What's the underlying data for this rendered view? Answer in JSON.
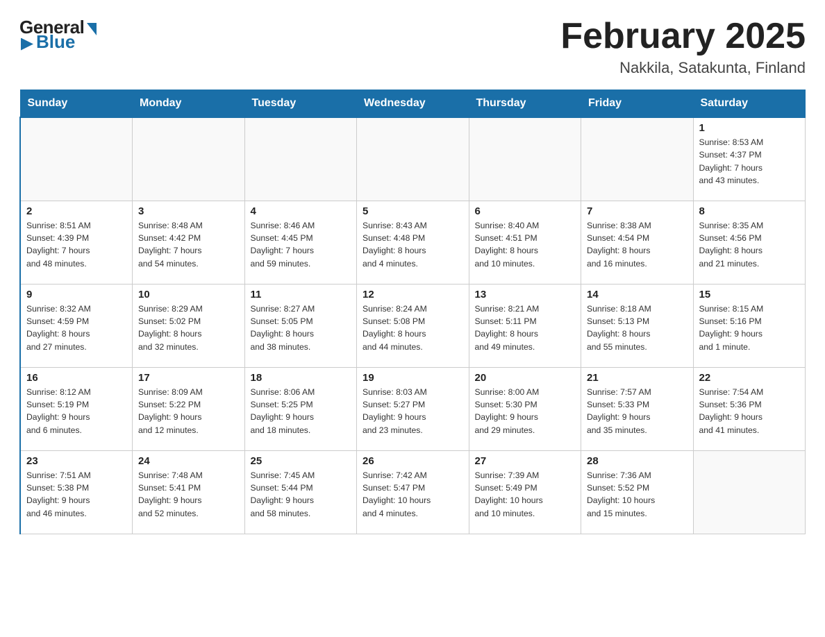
{
  "logo": {
    "general": "General",
    "blue": "Blue"
  },
  "header": {
    "month": "February 2025",
    "location": "Nakkila, Satakunta, Finland"
  },
  "weekdays": [
    "Sunday",
    "Monday",
    "Tuesday",
    "Wednesday",
    "Thursday",
    "Friday",
    "Saturday"
  ],
  "weeks": [
    [
      {
        "day": "",
        "info": ""
      },
      {
        "day": "",
        "info": ""
      },
      {
        "day": "",
        "info": ""
      },
      {
        "day": "",
        "info": ""
      },
      {
        "day": "",
        "info": ""
      },
      {
        "day": "",
        "info": ""
      },
      {
        "day": "1",
        "info": "Sunrise: 8:53 AM\nSunset: 4:37 PM\nDaylight: 7 hours\nand 43 minutes."
      }
    ],
    [
      {
        "day": "2",
        "info": "Sunrise: 8:51 AM\nSunset: 4:39 PM\nDaylight: 7 hours\nand 48 minutes."
      },
      {
        "day": "3",
        "info": "Sunrise: 8:48 AM\nSunset: 4:42 PM\nDaylight: 7 hours\nand 54 minutes."
      },
      {
        "day": "4",
        "info": "Sunrise: 8:46 AM\nSunset: 4:45 PM\nDaylight: 7 hours\nand 59 minutes."
      },
      {
        "day": "5",
        "info": "Sunrise: 8:43 AM\nSunset: 4:48 PM\nDaylight: 8 hours\nand 4 minutes."
      },
      {
        "day": "6",
        "info": "Sunrise: 8:40 AM\nSunset: 4:51 PM\nDaylight: 8 hours\nand 10 minutes."
      },
      {
        "day": "7",
        "info": "Sunrise: 8:38 AM\nSunset: 4:54 PM\nDaylight: 8 hours\nand 16 minutes."
      },
      {
        "day": "8",
        "info": "Sunrise: 8:35 AM\nSunset: 4:56 PM\nDaylight: 8 hours\nand 21 minutes."
      }
    ],
    [
      {
        "day": "9",
        "info": "Sunrise: 8:32 AM\nSunset: 4:59 PM\nDaylight: 8 hours\nand 27 minutes."
      },
      {
        "day": "10",
        "info": "Sunrise: 8:29 AM\nSunset: 5:02 PM\nDaylight: 8 hours\nand 32 minutes."
      },
      {
        "day": "11",
        "info": "Sunrise: 8:27 AM\nSunset: 5:05 PM\nDaylight: 8 hours\nand 38 minutes."
      },
      {
        "day": "12",
        "info": "Sunrise: 8:24 AM\nSunset: 5:08 PM\nDaylight: 8 hours\nand 44 minutes."
      },
      {
        "day": "13",
        "info": "Sunrise: 8:21 AM\nSunset: 5:11 PM\nDaylight: 8 hours\nand 49 minutes."
      },
      {
        "day": "14",
        "info": "Sunrise: 8:18 AM\nSunset: 5:13 PM\nDaylight: 8 hours\nand 55 minutes."
      },
      {
        "day": "15",
        "info": "Sunrise: 8:15 AM\nSunset: 5:16 PM\nDaylight: 9 hours\nand 1 minute."
      }
    ],
    [
      {
        "day": "16",
        "info": "Sunrise: 8:12 AM\nSunset: 5:19 PM\nDaylight: 9 hours\nand 6 minutes."
      },
      {
        "day": "17",
        "info": "Sunrise: 8:09 AM\nSunset: 5:22 PM\nDaylight: 9 hours\nand 12 minutes."
      },
      {
        "day": "18",
        "info": "Sunrise: 8:06 AM\nSunset: 5:25 PM\nDaylight: 9 hours\nand 18 minutes."
      },
      {
        "day": "19",
        "info": "Sunrise: 8:03 AM\nSunset: 5:27 PM\nDaylight: 9 hours\nand 23 minutes."
      },
      {
        "day": "20",
        "info": "Sunrise: 8:00 AM\nSunset: 5:30 PM\nDaylight: 9 hours\nand 29 minutes."
      },
      {
        "day": "21",
        "info": "Sunrise: 7:57 AM\nSunset: 5:33 PM\nDaylight: 9 hours\nand 35 minutes."
      },
      {
        "day": "22",
        "info": "Sunrise: 7:54 AM\nSunset: 5:36 PM\nDaylight: 9 hours\nand 41 minutes."
      }
    ],
    [
      {
        "day": "23",
        "info": "Sunrise: 7:51 AM\nSunset: 5:38 PM\nDaylight: 9 hours\nand 46 minutes."
      },
      {
        "day": "24",
        "info": "Sunrise: 7:48 AM\nSunset: 5:41 PM\nDaylight: 9 hours\nand 52 minutes."
      },
      {
        "day": "25",
        "info": "Sunrise: 7:45 AM\nSunset: 5:44 PM\nDaylight: 9 hours\nand 58 minutes."
      },
      {
        "day": "26",
        "info": "Sunrise: 7:42 AM\nSunset: 5:47 PM\nDaylight: 10 hours\nand 4 minutes."
      },
      {
        "day": "27",
        "info": "Sunrise: 7:39 AM\nSunset: 5:49 PM\nDaylight: 10 hours\nand 10 minutes."
      },
      {
        "day": "28",
        "info": "Sunrise: 7:36 AM\nSunset: 5:52 PM\nDaylight: 10 hours\nand 15 minutes."
      },
      {
        "day": "",
        "info": ""
      }
    ]
  ]
}
